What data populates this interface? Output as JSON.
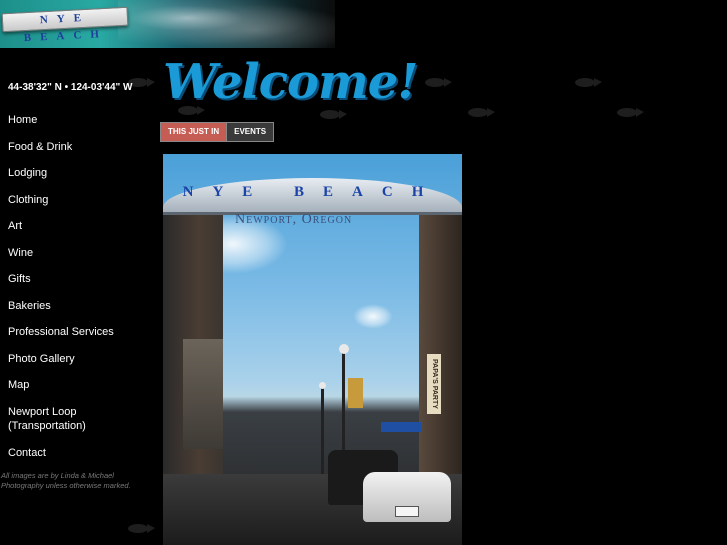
{
  "header": {
    "logo_text": "NYE BEACH"
  },
  "sidebar": {
    "coordinates": "44-38'32\" N • 124-03'44\" W",
    "nav": [
      {
        "label": "Home"
      },
      {
        "label": "Food & Drink"
      },
      {
        "label": "Lodging"
      },
      {
        "label": "Clothing"
      },
      {
        "label": "Art"
      },
      {
        "label": "Wine"
      },
      {
        "label": "Gifts"
      },
      {
        "label": "Bakeries"
      },
      {
        "label": "Professional Services"
      },
      {
        "label": "Photo Gallery"
      },
      {
        "label": "Map"
      },
      {
        "label": "Newport Loop (Transportation)"
      },
      {
        "label": "Contact"
      }
    ],
    "credit": "All images are by Linda & Michael Photography unless otherwise marked."
  },
  "main": {
    "heading": "Welcome!",
    "tabs": [
      {
        "label": "THIS JUST IN"
      },
      {
        "label": "EVENTS"
      }
    ],
    "photo": {
      "arch_text": "NYE BEACH",
      "arch_subtext": "Newport, Oregon",
      "sign_text": "PAPA'S PARTY"
    }
  },
  "colors": {
    "background": "#000000",
    "welcome_blue": "#1a9ad6",
    "tab_active": "#c65d55",
    "tab_inactive": "#3a3a3a",
    "credit_gray": "#7a7a7a"
  }
}
